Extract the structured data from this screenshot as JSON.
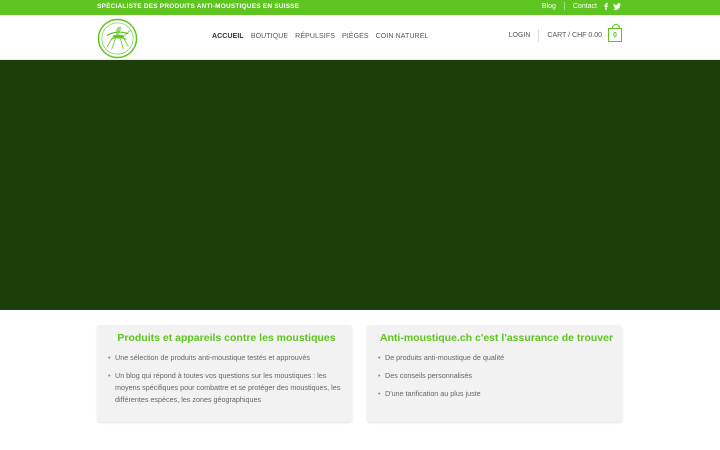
{
  "topbar": {
    "tagline": "SPÉCIALISTE DES PRODUITS ANTI-MOUSTIQUES EN SUISSE",
    "links": [
      "Blog",
      "Contact"
    ],
    "social": [
      "facebook-icon",
      "twitter-icon"
    ]
  },
  "header": {
    "logo": "mosquito-logo",
    "nav": [
      "ACCUEIL",
      "BOUTIQUE",
      "RÉPULSIFS",
      "PIÈGES",
      "COIN NATUREL"
    ],
    "login": "LOGIN",
    "cart": "CART / CHF 0.00",
    "cart_count": "0"
  },
  "hero": {
    "color": "#1c3e0a"
  },
  "cards": [
    {
      "title": "Produits et appareils contre les moustiques",
      "items": [
        "Une sélection de produits anti-moustique testés et approuvés",
        "Un blog qui répond à toutes vos questions sur les moustiques : les moyens spécifiques pour combattre et se protéger des moustiques, les différentes espèces, les zones géographiques"
      ]
    },
    {
      "title": "Anti-moustique.ch c'est l'assurance de trouver",
      "items": [
        "De produits anti-moustique de qualité",
        "Des conseils personnalisés",
        "D'une tarification au plus juste"
      ]
    }
  ],
  "colors": {
    "accent": "#5ec41f",
    "hero": "#1c3e0a"
  }
}
